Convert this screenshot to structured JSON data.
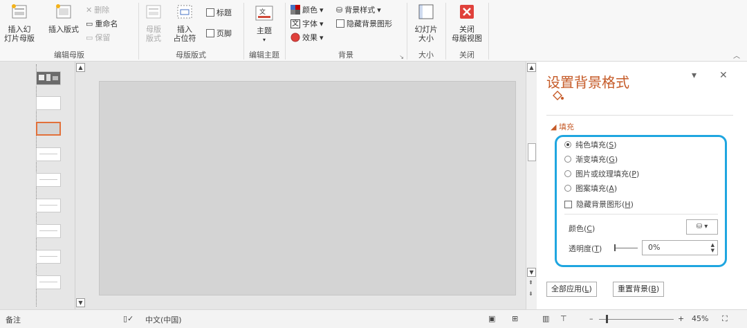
{
  "ribbon": {
    "edit_master": {
      "insert_slide_master": "插入幻\n灯片母版",
      "insert_layout": "插入版式",
      "delete": "删除",
      "rename": "重命名",
      "preserve": "保留",
      "group_label": "编辑母版"
    },
    "master_layout": {
      "master_layout_btn": "母版\n版式",
      "insert_placeholder": "插入\n占位符",
      "title_chk": "标题",
      "footer_chk": "页脚",
      "group_label": "母版版式"
    },
    "edit_theme": {
      "themes": "主题",
      "group_label": "编辑主题"
    },
    "background": {
      "colors": "颜色",
      "fonts": "字体",
      "effects": "效果",
      "bg_styles": "背景样式",
      "hide_bg": "隐藏背景图形",
      "group_label": "背景"
    },
    "size": {
      "slide_size": "幻灯片\n大小",
      "group_label": "大小"
    },
    "close": {
      "close_master": "关闭\n母版视图",
      "group_label": "关闭"
    }
  },
  "pane": {
    "title": "设置背景格式",
    "section_fill": "填充",
    "options": [
      {
        "label": "纯色填充(",
        "key": "S",
        "selected": true
      },
      {
        "label": "渐变填充(",
        "key": "G",
        "selected": false
      },
      {
        "label": "图片或纹理填充(",
        "key": "P",
        "selected": false
      },
      {
        "label": "图案填充(",
        "key": "A",
        "selected": false
      }
    ],
    "hide_bg_graphics": "隐藏背景图形(",
    "hide_bg_key": "H",
    "color_label": "颜色(",
    "color_key": "C",
    "transparency_label": "透明度(",
    "transparency_key": "T",
    "transparency_value": "0%",
    "apply_all": "全部应用(",
    "apply_all_key": "L",
    "reset_bg": "重置背景(",
    "reset_bg_key": "B"
  },
  "status": {
    "notes": "备注",
    "language": "中文(中国)",
    "zoom": "45%"
  },
  "colors": {
    "accent": "#c55a27",
    "callout": "#1fa6e0",
    "close_red": "#e0413b"
  }
}
